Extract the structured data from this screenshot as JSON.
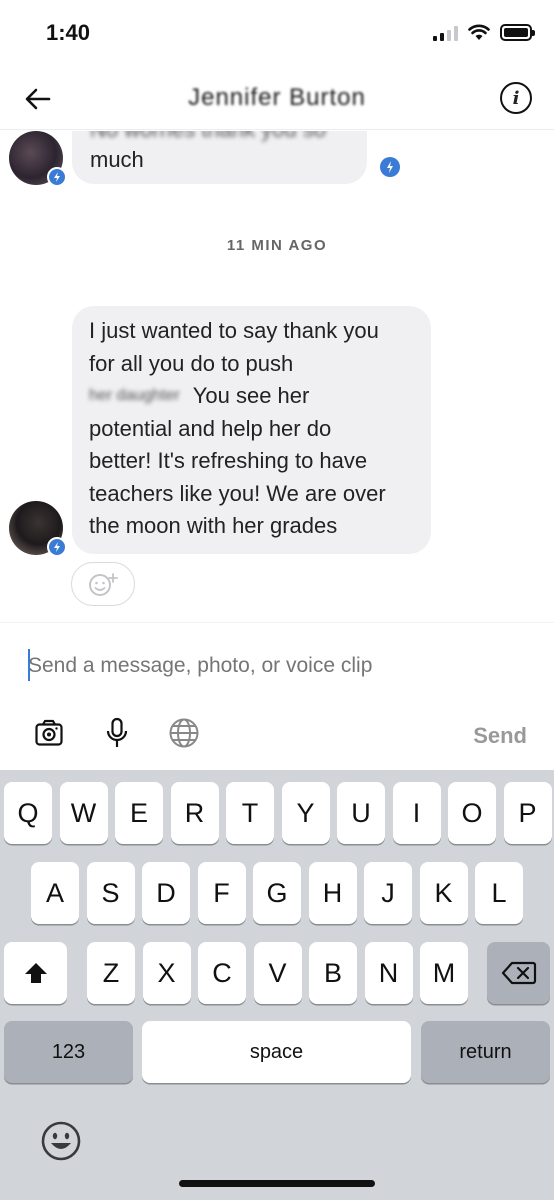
{
  "status_bar": {
    "time": "1:40"
  },
  "header": {
    "contact_name": "Jennifer Burton"
  },
  "messages": [
    {
      "text_line1": "No worries thank you so",
      "text_line2": "much"
    },
    {
      "lines": [
        "I just wanted to say thank you",
        "for all you do to push",
        "You see her",
        "potential and help her do",
        "better! It's refreshing to have",
        "teachers like you! We are over",
        "the moon with her grades"
      ],
      "redacted_name": "her daughter"
    }
  ],
  "time_separator": "11 MIN AGO",
  "composer": {
    "placeholder": "Send a message, photo, or voice clip",
    "send_label": "Send"
  },
  "keyboard": {
    "row1": [
      "Q",
      "W",
      "E",
      "R",
      "T",
      "Y",
      "U",
      "I",
      "O",
      "P"
    ],
    "row2": [
      "A",
      "S",
      "D",
      "F",
      "G",
      "H",
      "J",
      "K",
      "L"
    ],
    "row3": [
      "Z",
      "X",
      "C",
      "V",
      "B",
      "N",
      "M"
    ],
    "numbers_label": "123",
    "space_label": "space",
    "return_label": "return"
  },
  "colors": {
    "accent": "#3a7bd5",
    "bubble": "#f0f0f3",
    "keyboard_bg": "#d1d4d9"
  }
}
